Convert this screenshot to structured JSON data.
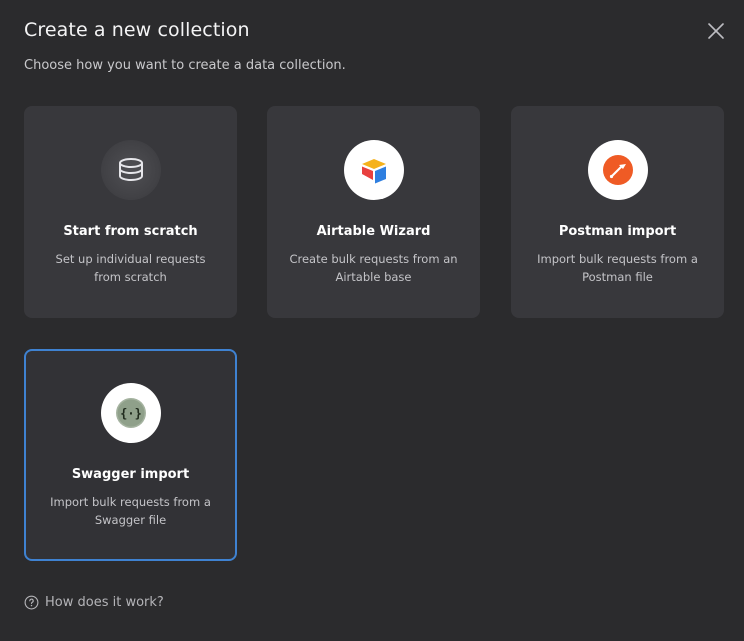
{
  "modal": {
    "title": "Create a new collection",
    "subtitle": "Choose how you want to create a data collection."
  },
  "options": [
    {
      "title": "Start from scratch",
      "description": "Set up individual requests from scratch",
      "icon": "database-icon"
    },
    {
      "title": "Airtable Wizard",
      "description": "Create bulk requests from an Airtable base",
      "icon": "airtable-icon"
    },
    {
      "title": "Postman import",
      "description": "Import bulk requests from a Postman file",
      "icon": "postman-icon"
    },
    {
      "title": "Swagger import",
      "description": "Import bulk requests from a Swagger file",
      "icon": "swagger-icon",
      "selected": true
    }
  ],
  "help": {
    "label": "How does it work?"
  },
  "colors": {
    "background": "#2b2b2d",
    "card": "#38383c",
    "selected_border": "#3f82d1",
    "postman": "#ef5b25",
    "swagger": "#85ea2d"
  }
}
